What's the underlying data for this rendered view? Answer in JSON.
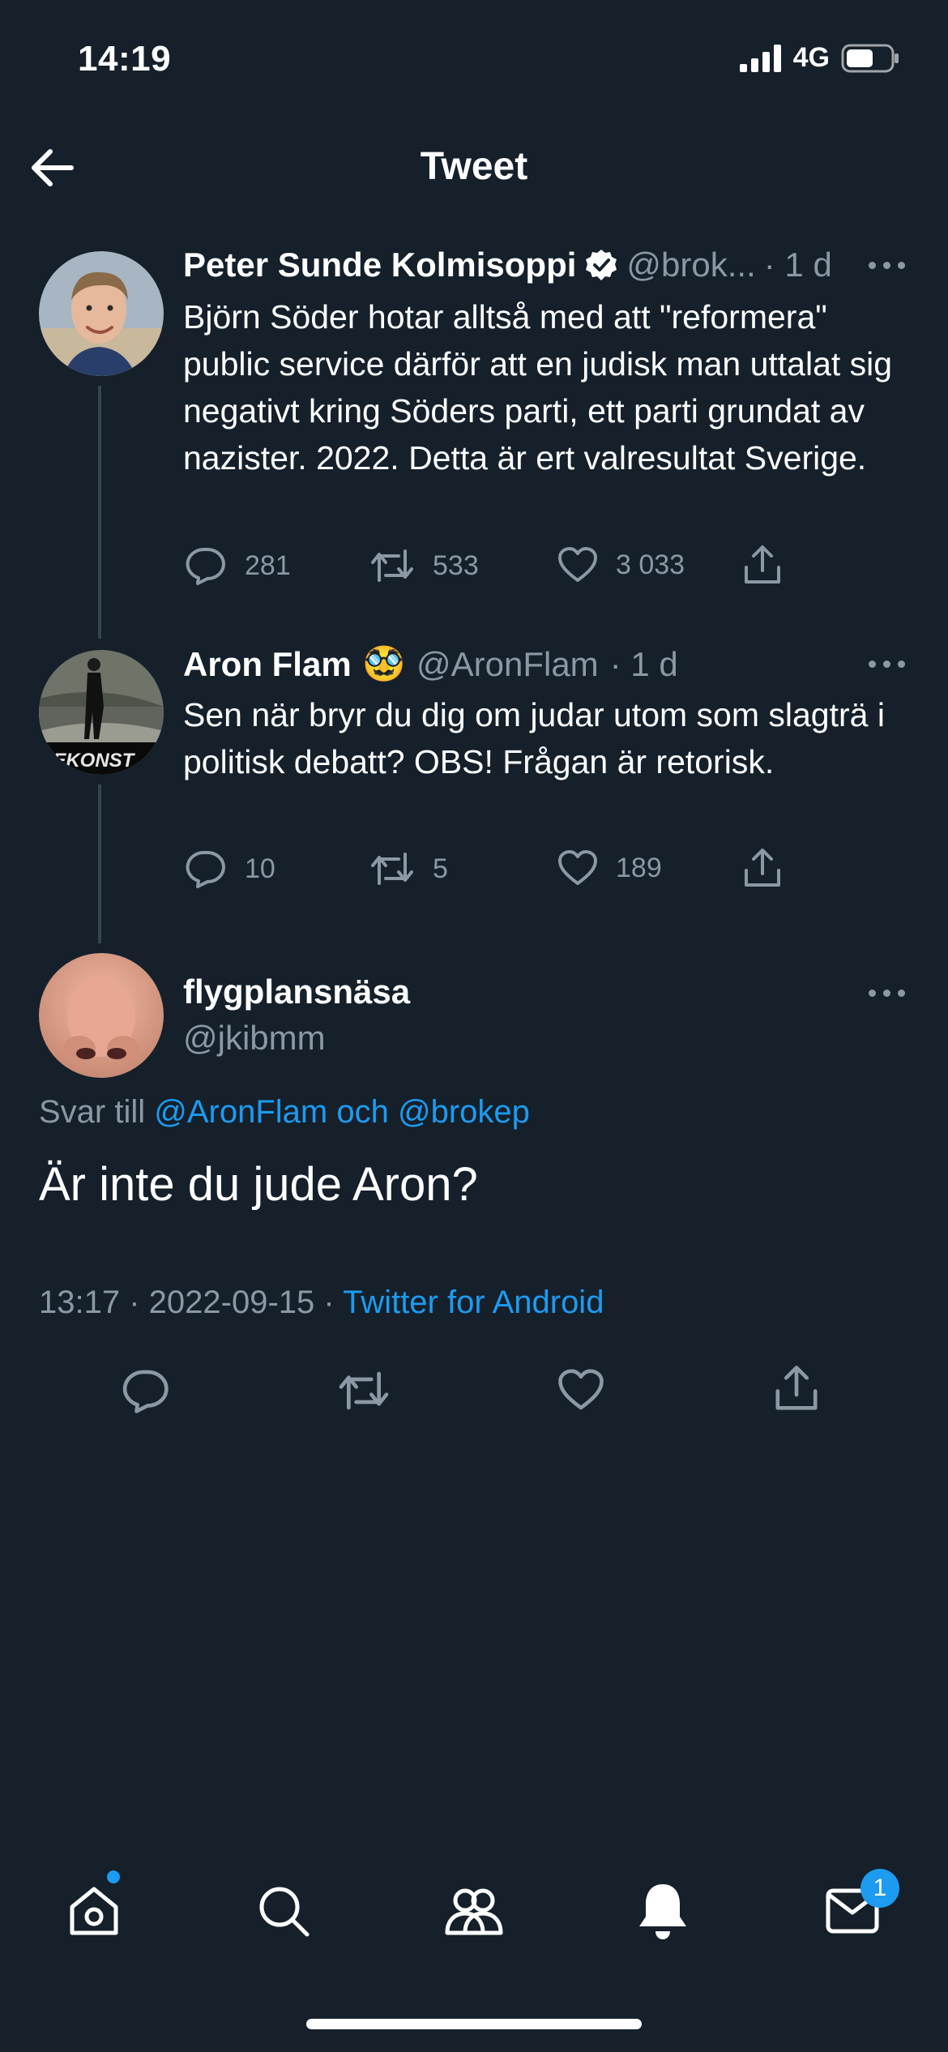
{
  "status_bar": {
    "time": "14:19",
    "network": "4G"
  },
  "header": {
    "title": "Tweet",
    "back_icon": "arrow-left-icon"
  },
  "thread": [
    {
      "name": "Peter Sunde Kolmisoppi",
      "verified": true,
      "handle": "@brok...",
      "time": "· 1 d",
      "text": "Björn Söder hotar alltså med att \"reformera\" public service därför att en judisk man uttalat sig negativt kring Söders parti, ett parti grundat av nazister. 2022. Detta är ert valresultat Sverige.",
      "replies": "281",
      "retweets": "533",
      "likes": "3 033"
    },
    {
      "name": "Aron Flam",
      "emoji": "🥸",
      "handle": "@AronFlam",
      "time": "· 1 d",
      "avatar_text": "REKONST",
      "text": "Sen när bryr du dig om judar utom som slagträ i politisk debatt? OBS! Frågan är retorisk.",
      "replies": "10",
      "retweets": "5",
      "likes": "189"
    }
  ],
  "main_tweet": {
    "name": "flygplansnäsa",
    "handle": "@jkibmm",
    "reply_prefix": "Svar till",
    "reply_mentions": "@AronFlam och @brokep",
    "text": "Är inte du jude Aron?",
    "timestamp": "13:17 · 2022-09-15 ·",
    "source": "Twitter for Android"
  },
  "bottom_nav": {
    "items": [
      "home-icon",
      "search-icon",
      "communities-icon",
      "notifications-icon",
      "messages-icon"
    ],
    "messages_badge": "1"
  },
  "colors": {
    "background": "#15202b",
    "accent": "#1d9bf0",
    "secondary_text": "#8b98a5",
    "divider": "#38444d"
  }
}
